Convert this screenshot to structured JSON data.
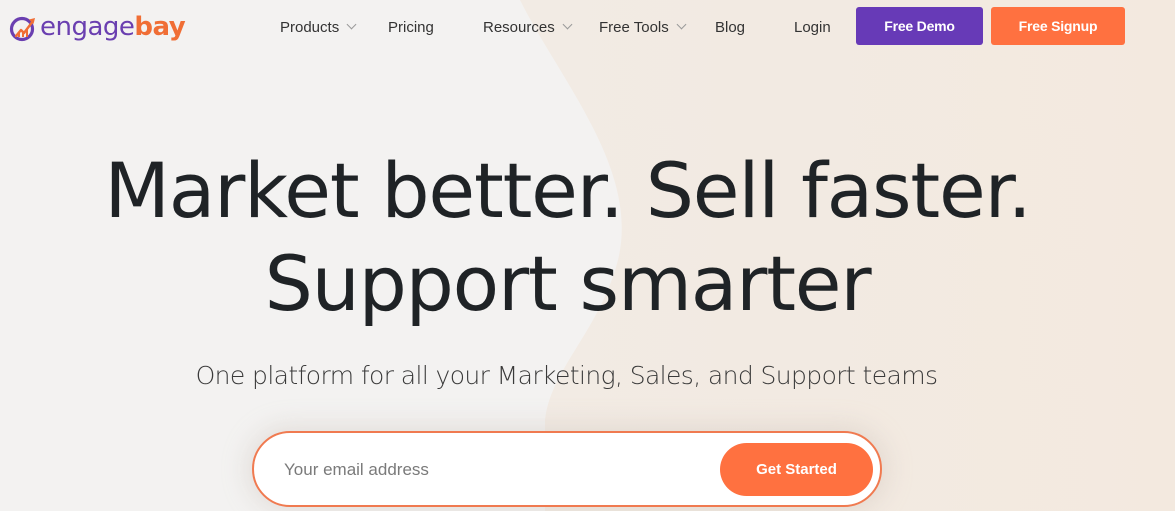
{
  "brand": {
    "name_part1": "engage",
    "name_part2": "bay",
    "logo_icon": "growth-chart-circle-icon",
    "colors": {
      "purple": "#673ab7",
      "orange": "#ff7140",
      "text_dark": "#1f2326",
      "bg_left": "#f3f2f1",
      "bg_right": "#f3ebe3"
    }
  },
  "nav": {
    "items": [
      {
        "label": "Products",
        "has_dropdown": true
      },
      {
        "label": "Pricing",
        "has_dropdown": false
      },
      {
        "label": "Resources",
        "has_dropdown": true
      },
      {
        "label": "Free Tools",
        "has_dropdown": true
      },
      {
        "label": "Blog",
        "has_dropdown": false
      },
      {
        "label": "Login",
        "has_dropdown": false
      }
    ],
    "demo_button": "Free Demo",
    "signup_button": "Free Signup"
  },
  "hero": {
    "title_line1": "Market better. Sell faster.",
    "title_line2": "Support smarter",
    "subtitle": "One platform for all your Marketing, Sales, and Support teams",
    "email_placeholder": "Your email address",
    "email_value": "",
    "cta_label": "Get Started"
  }
}
